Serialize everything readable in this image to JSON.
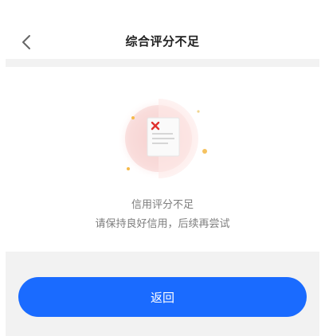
{
  "header": {
    "title": "综合评分不足",
    "back_icon": "chevron-left-icon"
  },
  "status": {
    "icon": "document-x-icon",
    "message": "信用评分不足",
    "hint": "请保持良好信用，后续再尝试"
  },
  "actions": {
    "return_label": "返回"
  },
  "colors": {
    "primary": "#1a6bff",
    "error": "#e0322f",
    "divider": "#f2f2f2",
    "text_secondary": "#7d7d7d"
  }
}
